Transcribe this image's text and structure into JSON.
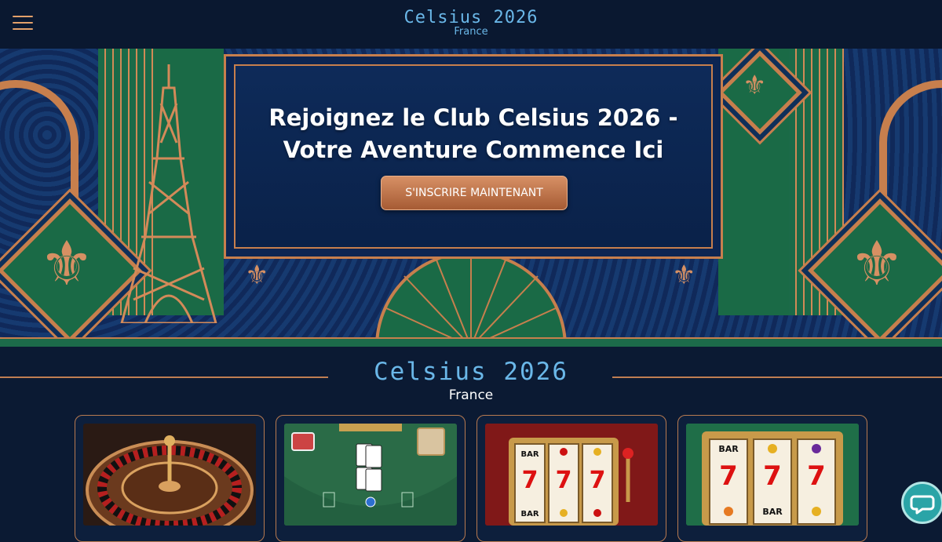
{
  "header": {
    "menu_icon": "hamburger-menu-icon",
    "logo_title": "Celsius 2026",
    "logo_subtitle": "France"
  },
  "hero": {
    "title_line1": "Rejoignez le Club Celsius 2026 -",
    "title_line2": "Votre Aventure Commence Ici",
    "cta_label": "S'INSCRIRE MAINTENANT"
  },
  "section": {
    "title": "Celsius 2026",
    "subtitle": "France"
  },
  "games": [
    {
      "name": "roulette-game-card",
      "icon": "roulette-wheel"
    },
    {
      "name": "blackjack-game-card",
      "icon": "blackjack-table"
    },
    {
      "name": "slot-machine-game-card",
      "icon": "slot-machine-777",
      "reel_labels": [
        "BAR",
        "BAR",
        "7",
        "7",
        "7"
      ]
    },
    {
      "name": "slots-777-game-card",
      "icon": "slot-machine-777",
      "reel_labels": [
        "BAR",
        "BAR",
        "7",
        "7",
        "7"
      ]
    }
  ],
  "colors": {
    "background": "#0b1a33",
    "accent_copper": "#c77f4d",
    "brand_blue": "#6ab7e8",
    "art_deco_green": "#1b6a48",
    "chat_teal": "#2aa4a7"
  },
  "chat": {
    "icon": "chat-bubble-icon"
  }
}
